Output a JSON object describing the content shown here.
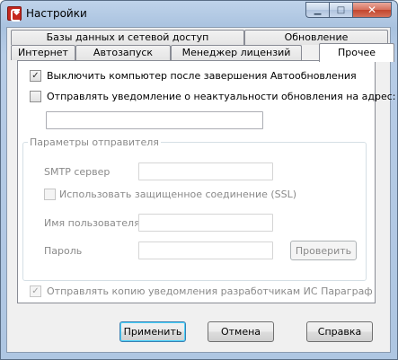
{
  "window": {
    "title": "Настройки",
    "close_glyph": "✕",
    "min_glyph": "▁",
    "max_glyph": "□"
  },
  "tabs": {
    "row_top": [
      "Базы данных и сетевой доступ",
      "Обновление"
    ],
    "row_bottom": [
      "Интернет",
      "Автозапуск",
      "Менеджер лицензий",
      "Прочее"
    ],
    "active": "Прочее"
  },
  "options": {
    "shutdown_after_update": {
      "label": "Выключить компьютер после завершения Автообновления",
      "checked": true
    },
    "notify_outdated": {
      "label": "Отправлять уведомление о неактуальности обновления на адрес:",
      "checked": false
    },
    "notify_address_value": ""
  },
  "sender": {
    "legend": "Параметры отправителя",
    "smtp_label": "SMTP сервер",
    "smtp_value": "",
    "ssl_label": "Использовать защищенное соединение (SSL)",
    "ssl_checked": false,
    "user_label": "Имя пользователя",
    "user_value": "",
    "password_label": "Пароль",
    "password_value": "",
    "check_button": "Проверить"
  },
  "copy_to_devs": {
    "label": "Отправлять копию уведомления разработчикам ИС Параграф",
    "checked": true
  },
  "buttons": {
    "apply": "Применить",
    "cancel": "Отмена",
    "help": "Справка"
  },
  "check_glyph": "✓"
}
